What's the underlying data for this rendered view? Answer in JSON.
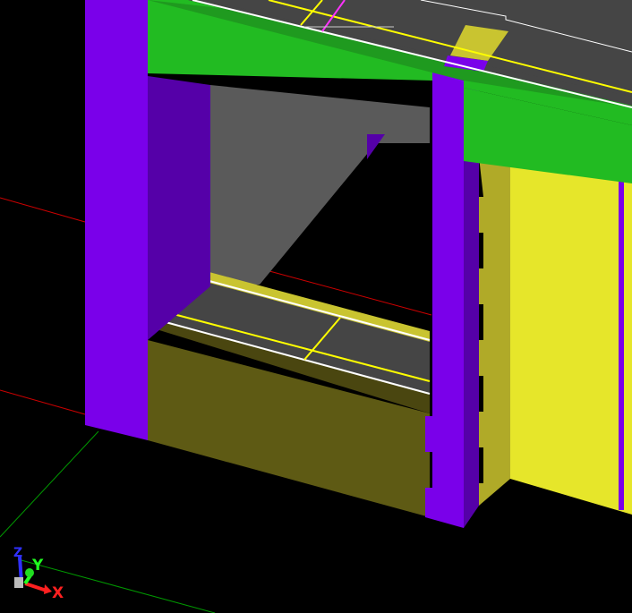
{
  "app": {
    "view": "3D viewport",
    "background": "#000000"
  },
  "colors": {
    "background": "#000000",
    "column_face": "#7a00ea",
    "column_side": "#5500a8",
    "beam_top_face": "#22bb22",
    "beam_dark_edge": "#1f9a1f",
    "slab_top": "#454545",
    "wall_grey": "#5a5a5a",
    "wall_olive_front": "#5e5a14",
    "wall_olive_top": "#4a4610",
    "wall_yellow_face": "#e6e62a",
    "wall_yellow_side": "#b0aa28",
    "line_yellow": "#ffff00",
    "line_white": "#ffffff",
    "line_magenta": "#ff33ff",
    "grid_red": "#cc0000",
    "grid_green": "#009900"
  },
  "axis_triad": {
    "x_label": "X",
    "y_label": "Y",
    "z_label": "Z",
    "x_color": "#ff2020",
    "y_color": "#20ff20",
    "z_color": "#3030ff"
  }
}
